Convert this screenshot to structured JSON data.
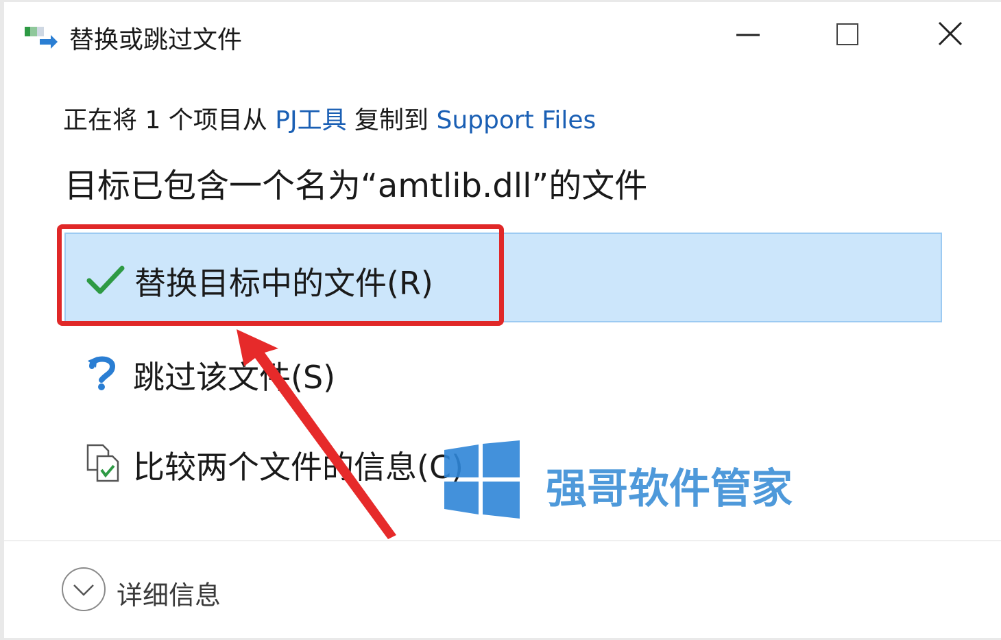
{
  "window": {
    "title": "替换或跳过文件",
    "icon": "file-move-icon"
  },
  "controls": {
    "minimize_icon": "minimize-icon",
    "maximize_icon": "maximize-icon",
    "close_icon": "close-icon"
  },
  "message": {
    "prefix": "正在将 1 个项目从 ",
    "source": "PJ工具",
    "middle": " 复制到 ",
    "destination": "Support Files"
  },
  "headline": "目标已包含一个名为“amtlib.dll”的文件",
  "options": [
    {
      "label": "替换目标中的文件(R)",
      "icon": "checkmark-icon",
      "selected": true
    },
    {
      "label": "跳过该文件(S)",
      "icon": "skip-arrow-icon",
      "selected": false
    },
    {
      "label": "比较两个文件的信息(C)",
      "icon": "compare-files-icon",
      "selected": false
    }
  ],
  "details": {
    "label": "详细信息",
    "icon": "chevron-down-icon"
  },
  "watermark": {
    "text": "强哥软件管家",
    "logo": "windows-logo-icon"
  },
  "colors": {
    "selected_bg": "#cce6fb",
    "selected_border": "#9ccaf2",
    "highlight_red": "#e02828",
    "link_blue": "#1a5fb4",
    "check_green": "#2e9a44",
    "watermark_blue": "#3b8fd6"
  }
}
